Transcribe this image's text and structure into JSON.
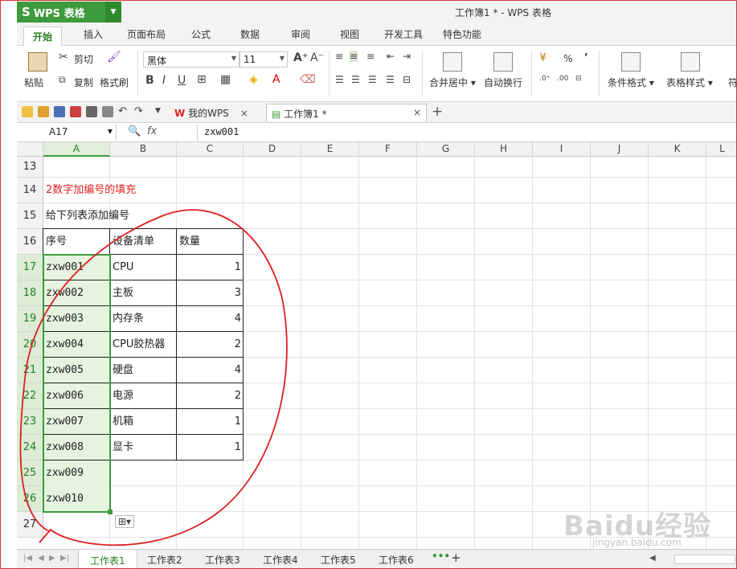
{
  "window": {
    "app_name": "WPS 表格",
    "title": "工作簿1 * - WPS 表格"
  },
  "ribbon_tabs": [
    "开始",
    "插入",
    "页面布局",
    "公式",
    "数据",
    "审阅",
    "视图",
    "开发工具",
    "特色功能"
  ],
  "ribbon": {
    "paste": "粘贴",
    "cut": "剪切",
    "copy": "复制",
    "format_painter": "格式刷",
    "font_name": "黑体",
    "font_size": "11",
    "merge_center": "合并居中",
    "wrap_text": "自动换行",
    "percent": "%",
    "comma": "’",
    "conditional_format": "条件格式",
    "table_style": "表格样式",
    "truncated": "符"
  },
  "doc_tabs": [
    {
      "label": "我的WPS",
      "close": "×"
    },
    {
      "label": "工作簿1 *",
      "close": "×"
    }
  ],
  "doc_tabs_add": "+",
  "formula_bar": {
    "name_box": "A17",
    "fx": "fx",
    "content": "zxw001"
  },
  "columns": [
    "A",
    "B",
    "C",
    "D",
    "E",
    "F",
    "G",
    "H",
    "I",
    "J",
    "K",
    "L"
  ],
  "rows": [
    "13",
    "14",
    "15",
    "16",
    "17",
    "18",
    "19",
    "20",
    "21",
    "22",
    "23",
    "24",
    "25",
    "26",
    "27"
  ],
  "cells": {
    "title": "2数字加编号的填充",
    "subtitle": "给下列表添加编号",
    "headers": [
      "序号",
      "设备清单",
      "数量"
    ],
    "table": [
      {
        "id": "zxw001",
        "item": "CPU",
        "qty": "1"
      },
      {
        "id": "zxw002",
        "item": "主板",
        "qty": "3"
      },
      {
        "id": "zxw003",
        "item": "内存条",
        "qty": "4"
      },
      {
        "id": "zxw004",
        "item": "CPU胶热器",
        "qty": "2"
      },
      {
        "id": "zxw005",
        "item": "硬盘",
        "qty": "4"
      },
      {
        "id": "zxw006",
        "item": "电源",
        "qty": "2"
      },
      {
        "id": "zxw007",
        "item": "机箱",
        "qty": "1"
      },
      {
        "id": "zxw008",
        "item": "显卡",
        "qty": "1"
      },
      {
        "id": "zxw009",
        "item": "",
        "qty": ""
      },
      {
        "id": "zxw010",
        "item": "",
        "qty": ""
      }
    ]
  },
  "sheet_tabs": [
    "工作表1",
    "工作表2",
    "工作表3",
    "工作表4",
    "工作表5",
    "工作表6"
  ],
  "sheet_more": "•••",
  "sheet_add": "+",
  "watermark": {
    "main": "Baidu经验",
    "sub": "jingyan.baidu.com"
  },
  "colors": {
    "accent": "#3d9b3d",
    "title_red": "#e02020",
    "annotation": "#dd1f1f"
  }
}
